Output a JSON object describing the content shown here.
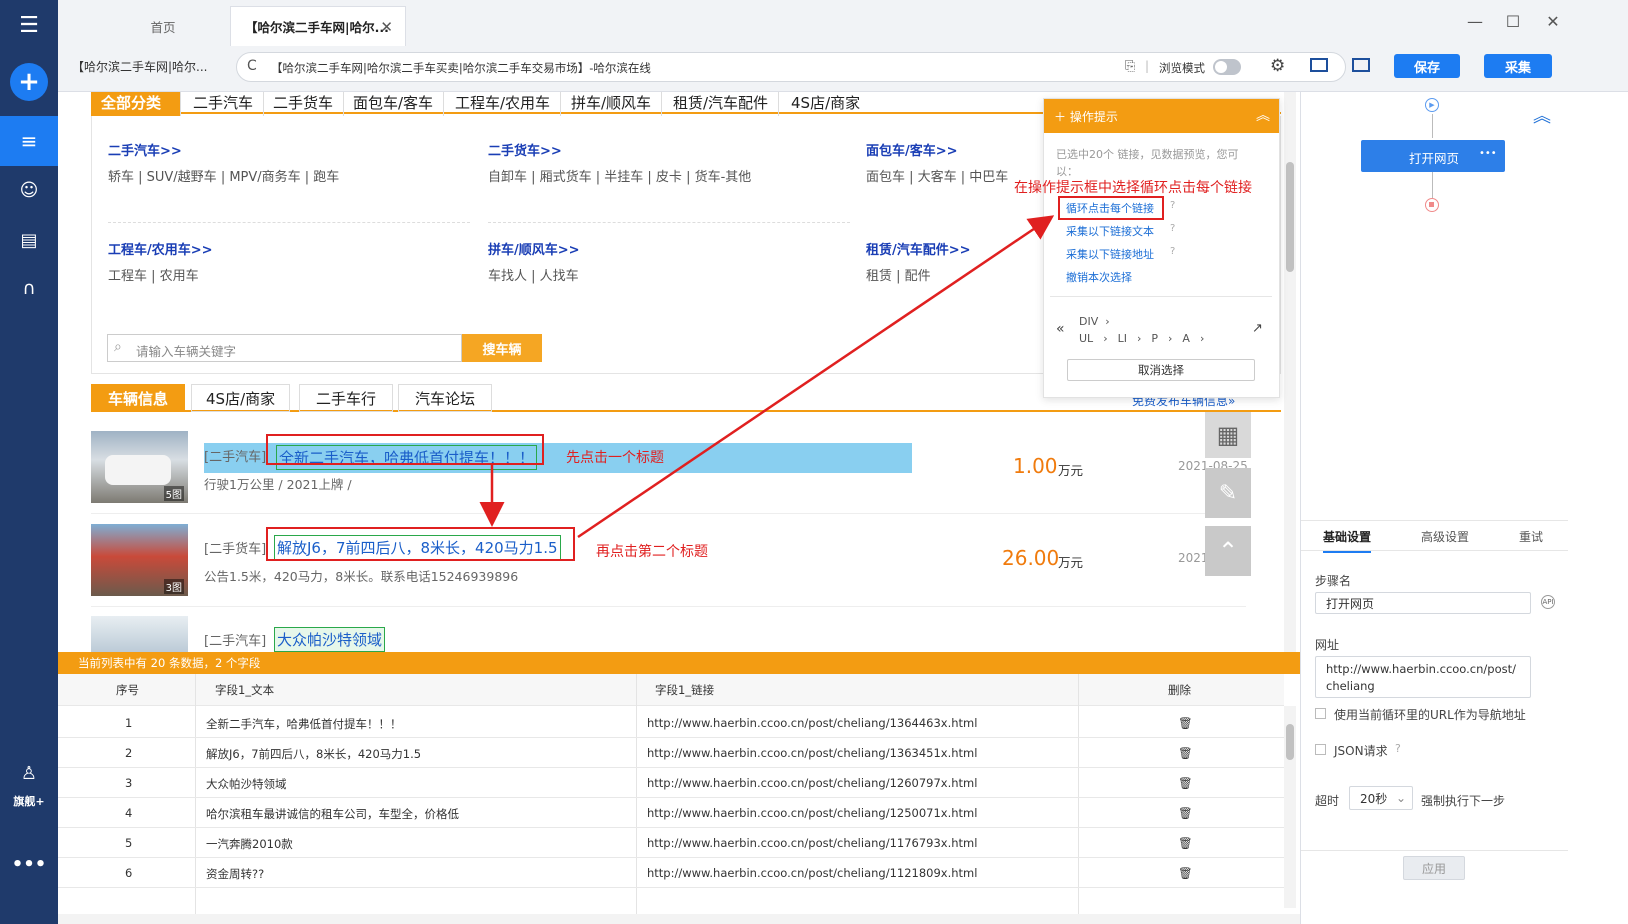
{
  "sidebar": {
    "user_label": "旗舰+"
  },
  "tabs": [
    {
      "label": "首页"
    },
    {
      "label": "【哈尔滨二手车网|哈尔..."
    }
  ],
  "address": {
    "short_title": "【哈尔滨二手车网|哈尔...",
    "url_text": "【哈尔滨二手车网|哈尔滨二手车买卖|哈尔滨二手车交易市场】-哈尔滨在线",
    "browse_mode": "浏览模式"
  },
  "toolbar": {
    "save": "保存",
    "collect": "采集"
  },
  "category_tabs": [
    "全部分类",
    "二手汽车",
    "二手货车",
    "面包车/客车",
    "工程车/农用车",
    "拼车/顺风车",
    "租赁/汽车配件",
    "4S店/商家"
  ],
  "categories": [
    {
      "title": "二手汽车>>",
      "links": "轿车 | SUV/越野车 | MPV/商务车 | 跑车"
    },
    {
      "title": "二手货车>>",
      "links": "自卸车 | 厢式货车 | 半挂车 | 皮卡 | 货车-其他"
    },
    {
      "title": "面包车/客车>>",
      "links": "面包车 | 大客车 | 中巴车"
    },
    {
      "title": "工程车/农用车>>",
      "links": "工程车 | 农用车"
    },
    {
      "title": "拼车/顺风车>>",
      "links": "车找人 | 人找车"
    },
    {
      "title": "租赁/汽车配件>>",
      "links": "租赁 | 配件"
    }
  ],
  "search": {
    "placeholder": "请输入车辆关键字",
    "button": "搜车辆"
  },
  "info_tabs": [
    "车辆信息",
    "4S店/商家",
    "二手车行",
    "汽车论坛"
  ],
  "free_publish": "免费发布车辆信息»",
  "listings": [
    {
      "tag": "[二手汽车]",
      "title": "全新二手汽车，哈弗低首付提车！！！",
      "meta": "行驶1万公里 / 2021上牌 /",
      "price": "1.00",
      "unit": "万元",
      "date": "2021-08-25",
      "photos": "5图"
    },
    {
      "tag": "[二手货车]",
      "title": "解放J6，7前四后八，8米长，420马力1.5",
      "meta": "公告1.5米，420马力，8米长。联系电话15246939896",
      "price": "26.00",
      "unit": "万元",
      "date": "2021",
      "photos": "3图"
    },
    {
      "tag": "[二手汽车]",
      "title": "大众帕沙特领域",
      "meta": "",
      "price": "",
      "unit": "",
      "date": "",
      "photos": ""
    }
  ],
  "annotations": {
    "step1": "先点击一个标题",
    "step2": "再点击第二个标题",
    "step3": "在操作提示框中选择循环点击每个链接"
  },
  "panel": {
    "title": "操作提示",
    "desc": "已选中20个 链接，见数据预览，您可以：",
    "options": [
      "循环点击每个链接",
      "采集以下链接文本",
      "采集以下链接地址",
      "撤销本次选择"
    ],
    "crumbs_row1": [
      "DIV"
    ],
    "crumbs_row2": [
      "UL",
      "LI",
      "P",
      "A"
    ],
    "cancel": "取消选择"
  },
  "data_summary": "当前列表中有 20 条数据，2 个字段",
  "table": {
    "headers": [
      "序号",
      "字段1_文本",
      "字段1_链接",
      "删除"
    ],
    "rows": [
      [
        "1",
        "全新二手汽车，哈弗低首付提车！！！",
        "http://www.haerbin.ccoo.cn/post/cheliang/1364463x.html"
      ],
      [
        "2",
        "解放J6，7前四后八，8米长，420马力1.5",
        "http://www.haerbin.ccoo.cn/post/cheliang/1363451x.html"
      ],
      [
        "3",
        "大众帕沙特领域",
        "http://www.haerbin.ccoo.cn/post/cheliang/1260797x.html"
      ],
      [
        "4",
        "哈尔滨租车最讲诚信的租车公司，车型全，价格低",
        "http://www.haerbin.ccoo.cn/post/cheliang/1250071x.html"
      ],
      [
        "5",
        "一汽奔腾2010款",
        "http://www.haerbin.ccoo.cn/post/cheliang/1176793x.html"
      ],
      [
        "6",
        "资金周转??",
        "http://www.haerbin.ccoo.cn/post/cheliang/1121809x.html"
      ]
    ]
  },
  "flow": {
    "node": "打开网页",
    "node_more": "•••"
  },
  "settings": {
    "tabs": [
      "基础设置",
      "高级设置",
      "重试"
    ],
    "step_name_label": "步骤名",
    "step_name": "打开网页",
    "url_label": "网址",
    "url": "http://www.haerbin.ccoo.cn/post/cheliang",
    "use_loop_url": "使用当前循环里的URL作为导航地址",
    "json_request": "JSON请求",
    "timeout_label": "超时",
    "timeout": "20秒",
    "force_next": "强制执行下一步",
    "apply": "应用"
  },
  "colors": {
    "sidebar": "#1f3a6b",
    "accent": "#1d7cf2",
    "orange": "#f39c12",
    "red": "#e02020"
  }
}
